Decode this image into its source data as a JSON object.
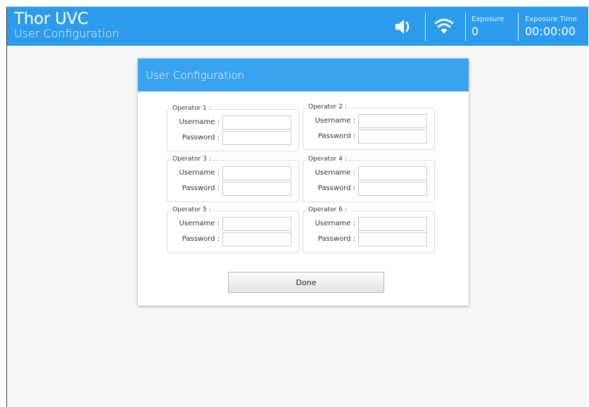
{
  "app": {
    "title": "Thor UVC",
    "subtitle": "User Configuration"
  },
  "status": {
    "exposure_label": "Exposure",
    "exposure_value": "0",
    "exposure_time_label": "Exposure Time",
    "exposure_time_value": "00:00:00",
    "icons": [
      "speaker-icon",
      "wifi-icon"
    ]
  },
  "dialog": {
    "title": "User Configuration",
    "username_label": "Username :",
    "password_label": "Password :",
    "operators": [
      {
        "label": "Operator 1 :",
        "username": "",
        "password": ""
      },
      {
        "label": "Operator 2 :",
        "username": "",
        "password": ""
      },
      {
        "label": "Operator 3 :",
        "username": "",
        "password": ""
      },
      {
        "label": "Operator 4 :",
        "username": "",
        "password": ""
      },
      {
        "label": "Operator 5 :",
        "username": "",
        "password": ""
      },
      {
        "label": "Operator 6 :",
        "username": "",
        "password": ""
      }
    ],
    "done_label": "Done"
  },
  "colors": {
    "appbar": "#2d9bec",
    "dialog_header": "#3aa3f0",
    "background": "#f7f7f7"
  }
}
